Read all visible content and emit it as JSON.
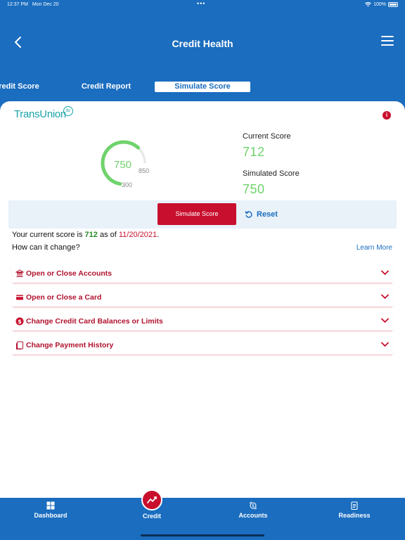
{
  "status_bar": {
    "time": "12:37 PM",
    "date": "Mon Dec 20",
    "battery": "100%"
  },
  "header": {
    "title": "Credit Health"
  },
  "tabs": [
    {
      "label": "Credit Score"
    },
    {
      "label": "Credit Report"
    },
    {
      "label": "Simulate Score"
    }
  ],
  "brand": {
    "logo_text": "TransUnion",
    "logo_mark": "tu",
    "info_glyph": "i"
  },
  "gauge": {
    "score": "750",
    "max": "850",
    "min": "300",
    "fraction": 0.82
  },
  "scores": {
    "current_label": "Current Score",
    "current_value": "712",
    "simulated_label": "Simulated Score",
    "simulated_value": "750"
  },
  "actions": {
    "simulate_label": "Simulate Score",
    "reset_label": "Reset"
  },
  "summary": {
    "prefix": "Your current score is ",
    "score": "712",
    "middle": " as of ",
    "date": "11/20/2021",
    "suffix": ".",
    "question": "How can it change?",
    "learn_more": "Learn More"
  },
  "accordions": [
    {
      "label": "Open or Close Accounts",
      "icon": "bank-icon"
    },
    {
      "label": "Open or Close a Card",
      "icon": "credit-card-icon"
    },
    {
      "label": "Change Credit Card Balances or Limits",
      "icon": "dollar-icon"
    },
    {
      "label": "Change Payment History",
      "icon": "document-icon"
    }
  ],
  "bottom_nav": [
    {
      "label": "Dashboard",
      "icon": "grid-icon"
    },
    {
      "label": "Credit",
      "icon": "trend-icon"
    },
    {
      "label": "Accounts",
      "icon": "accounts-icon"
    },
    {
      "label": "Readiness",
      "icon": "checklist-icon"
    }
  ],
  "colors": {
    "primary": "#1a6dbf",
    "accent_red": "#c8102e",
    "score_green": "#6fd36b",
    "teal": "#1aa3a8"
  }
}
